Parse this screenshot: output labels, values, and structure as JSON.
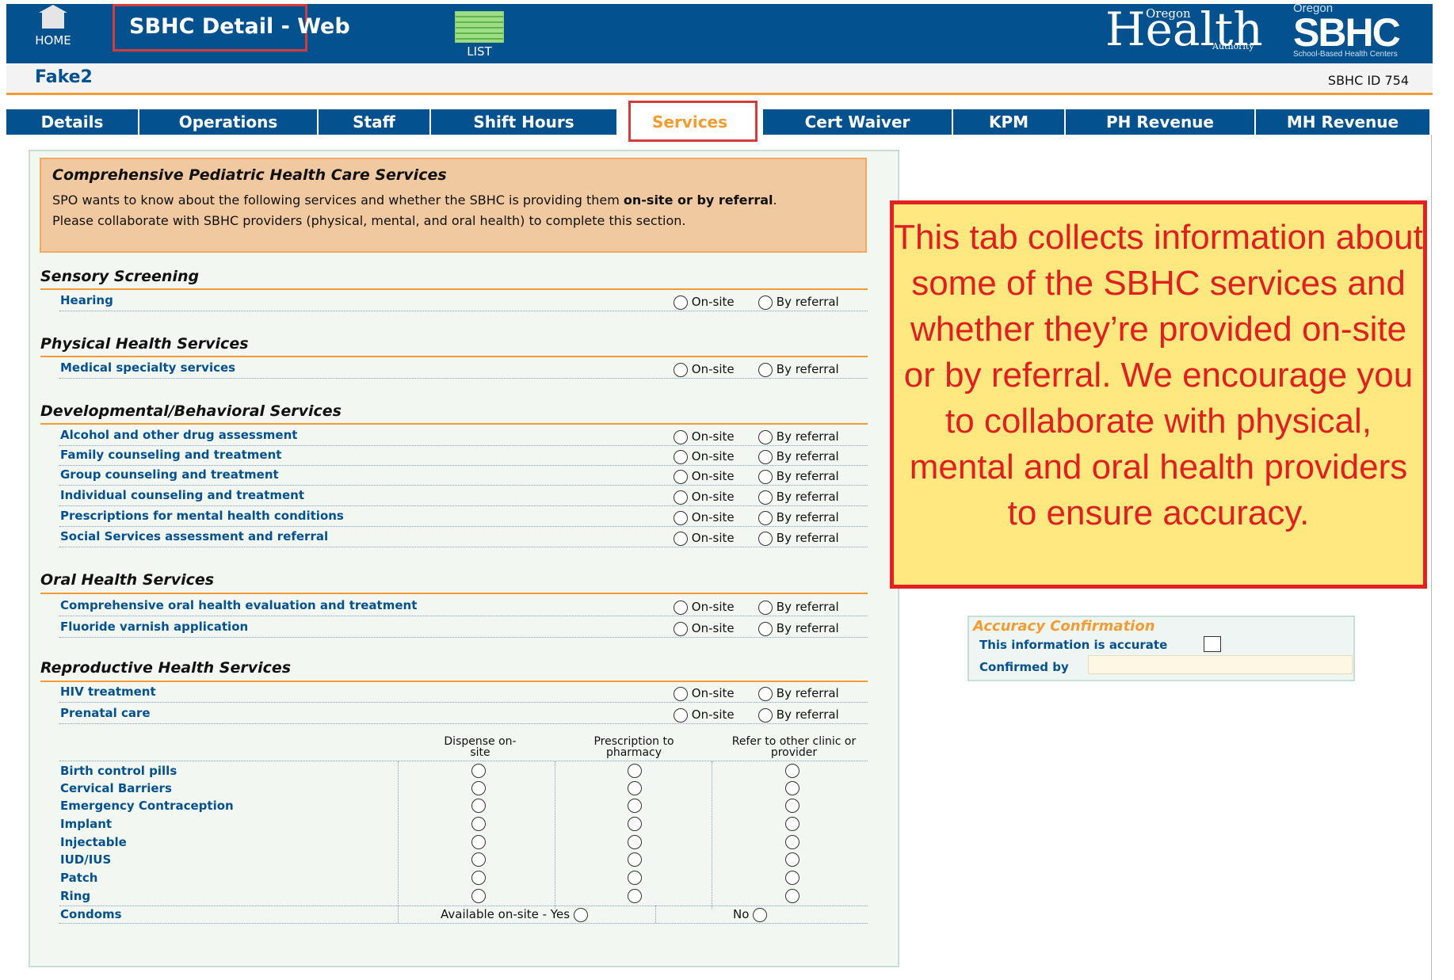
{
  "header": {
    "home_label": "HOME",
    "title": "SBHC Detail - Web",
    "list_label": "LIST",
    "logo_health": "Health",
    "logo_oregon": "Oregon",
    "logo_authority": "Authority",
    "logo_sbhc": "SBHC",
    "logo_sbhc_oregon": "Oregon",
    "logo_sbhc_sub": "School-Based Health Centers"
  },
  "site": {
    "name": "Fake2",
    "id_text": "SBHC ID 754"
  },
  "tabs": [
    {
      "label": "Details"
    },
    {
      "label": "Operations"
    },
    {
      "label": "Staff"
    },
    {
      "label": "Shift Hours"
    },
    {
      "label": "Services"
    },
    {
      "label": "Cert Waiver"
    },
    {
      "label": "KPM"
    },
    {
      "label": "PH Revenue"
    },
    {
      "label": "MH Revenue"
    }
  ],
  "active_tab": "Services",
  "intro": {
    "title": "Comprehensive Pediatric Health Care Services",
    "line1_a": "SPO wants to know about the following services and whether the SBHC is providing them ",
    "line1_b": "on-site or by referral",
    "line1_c": ".",
    "line2": "Please collaborate with SBHC providers (physical, mental, and oral health) to complete this section."
  },
  "options": {
    "onsite": "On-site",
    "referral": "By referral"
  },
  "sections": [
    {
      "title": "Sensory Screening",
      "items": [
        "Hearing"
      ]
    },
    {
      "title": "Physical Health Services",
      "items": [
        "Medical specialty services"
      ]
    },
    {
      "title": "Developmental/Behavioral Services",
      "items": [
        "Alcohol and other drug assessment",
        "Family counseling and treatment",
        "Group counseling and treatment",
        "Individual counseling and treatment",
        "Prescriptions for mental health conditions",
        "Social Services assessment and referral"
      ]
    },
    {
      "title": "Oral Health Services",
      "items": [
        "Comprehensive oral health evaluation and treatment",
        "Fluoride varnish application"
      ]
    },
    {
      "title": "Reproductive Health Services",
      "items": [
        "HIV treatment",
        "Prenatal care"
      ]
    }
  ],
  "repro_table": {
    "col1": "Dispense on-site",
    "col2": "Prescription to pharmacy",
    "col3": "Refer to other clinic or provider",
    "rows": [
      "Birth control pills",
      "Cervical Barriers",
      "Emergency Contraception",
      "Implant",
      "Injectable",
      "IUD/IUS",
      "Patch",
      "Ring"
    ],
    "condoms_label": "Condoms",
    "condoms_yes": "Available on-site - Yes",
    "condoms_no": "No"
  },
  "callout": "This tab collects information about some of the SBHC services and whether they’re provided on-site or by referral. We encourage you to collaborate with physical, mental and oral health providers to ensure accuracy.",
  "accuracy": {
    "title": "Accuracy Confirmation",
    "accurate_label": "This information is accurate",
    "confirmed_label": "Confirmed by",
    "confirmed_value": ""
  },
  "colors": {
    "header_blue": "#03528f",
    "accent_orange": "#f39c32",
    "callout_red": "#e52020",
    "callout_bg": "#fee87f"
  }
}
